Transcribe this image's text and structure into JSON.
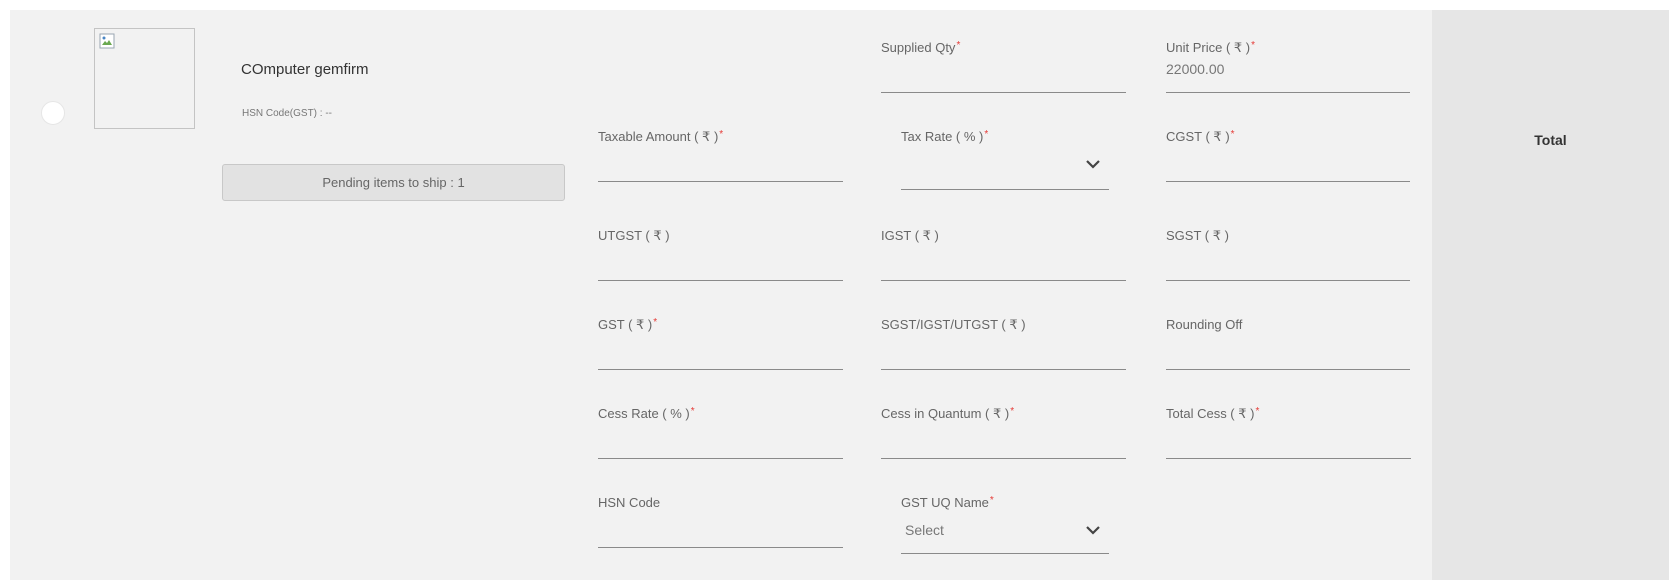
{
  "product": {
    "name": "COmputer gemfirm",
    "hsn_meta": "HSN Code(GST) : --",
    "pending_label": "Pending items to ship : 1"
  },
  "total": {
    "label": "Total"
  },
  "required_marker": "*",
  "fields": {
    "supplied_qty": {
      "label": "Supplied Qty",
      "value": ""
    },
    "unit_price": {
      "label": "Unit Price ( ₹ )",
      "value": "22000.00"
    },
    "taxable_amount": {
      "label": "Taxable Amount ( ₹ )",
      "value": ""
    },
    "tax_rate": {
      "label": "Tax Rate ( % )",
      "value": ""
    },
    "cgst": {
      "label": "CGST ( ₹ )",
      "value": ""
    },
    "utgst": {
      "label": "UTGST ( ₹ )",
      "value": ""
    },
    "igst": {
      "label": "IGST ( ₹ )",
      "value": ""
    },
    "sgst": {
      "label": "SGST ( ₹ )",
      "value": ""
    },
    "gst": {
      "label": "GST ( ₹ )",
      "value": ""
    },
    "sgst_igst_utgst": {
      "label": "SGST/IGST/UTGST ( ₹ )",
      "value": ""
    },
    "rounding_off": {
      "label": "Rounding Off",
      "value": ""
    },
    "cess_rate": {
      "label": "Cess Rate ( % )",
      "value": ""
    },
    "cess_in_quantum": {
      "label": "Cess in Quantum ( ₹ )",
      "value": ""
    },
    "total_cess": {
      "label": "Total Cess ( ₹ )",
      "value": ""
    },
    "hsn_code": {
      "label": "HSN Code",
      "value": ""
    },
    "gst_uq_name": {
      "label": "GST UQ Name",
      "value": "Select"
    }
  },
  "icons": {
    "broken_image": "broken-image-icon",
    "dropdown": "chevron-down-icon"
  },
  "colors": {
    "card_bg": "#f2f2f2",
    "total_bg": "#e6e6e6",
    "required": "#e53935",
    "underline": "#8a8a8a"
  }
}
